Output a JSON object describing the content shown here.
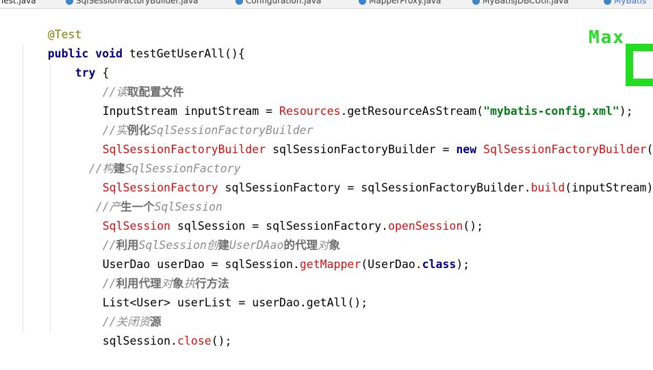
{
  "tabs": [
    {
      "label": "Test.java"
    },
    {
      "label": "SqlSessionFactoryBuilder.java"
    },
    {
      "label": "Configuration.java"
    },
    {
      "label": "MapperProxy.java"
    },
    {
      "label": "MyBatisJDBCUtil.java"
    },
    {
      "label": "MyBatis"
    }
  ],
  "code": {
    "l1": {
      "anno": "@Test"
    },
    "l2": {
      "kw1": "public",
      "kw2": "void",
      "name": "testGetUserAll",
      "rest": "(){"
    },
    "l3": {
      "kw": "try",
      "rest": " {"
    },
    "l4": {
      "c1": "//读",
      "c2": "取配置文件"
    },
    "l5": {
      "t1": "InputStream inputStream = ",
      "cls": "Resources",
      "t2": ".getResourceAsStream(",
      "str": "\"mybatis-config.xml\"",
      "t3": ");"
    },
    "l6": {
      "c1": "//实",
      "c2": "例化",
      "c3": "SqlSessionFactoryBuilder"
    },
    "l7": {
      "cls1": "SqlSessionFactoryBuilder",
      "t1": " sqlSessionFactoryBuilder = ",
      "kw": "new",
      "sp": " ",
      "cls2": "SqlSessionFactoryBuilder",
      "t2": "();"
    },
    "l8": {
      "c1": "//构",
      "c2": "建",
      "c3": "SqlSessionFactory"
    },
    "l9": {
      "cls": "SqlSessionFactory",
      "t1": " sqlSessionFactory = sqlSessionFactoryBuilder.",
      "mth": "build",
      "t2": "(inputStream);"
    },
    "l10": {
      "c1": "//产",
      "c2": "生一个",
      "c3": "SqlSession"
    },
    "l11": {
      "cls": "SqlSession",
      "t1": " sqlSession = sqlSessionFactory.",
      "mth": "openSession",
      "t2": "();"
    },
    "l12": {
      "c1": "//",
      "c2": "利用",
      "c3": "SqlSession",
      "c4": "创",
      "c5": "建",
      "c6": "UserDAao",
      "c7": "的代理",
      "c8": "对",
      "c9": "象"
    },
    "l13": {
      "t1": "UserDao userDao = sqlSession.",
      "mth": "getMapper",
      "t2": "(UserDao.",
      "kw": "class",
      "t3": ");"
    },
    "l14": {
      "c1": "//",
      "c2": "利用代理",
      "c3": "对",
      "c4": "象",
      "c5": "执",
      "c6": "行方法"
    },
    "l15": {
      "t1": "List<User> userList = userDao.getAll();"
    },
    "l16": {
      "c1": "//关闭资",
      "c2": "源"
    },
    "l17": {
      "t1": "sqlSession.",
      "mth": "close",
      "t2": "();"
    }
  },
  "overlay": {
    "text": "Max",
    "color": "#22dd22"
  },
  "colors": {
    "keyword": "#000080",
    "class": "#d40f0f",
    "string": "#067d17",
    "comment": "#8c8c8c",
    "annotation": "#808000"
  }
}
